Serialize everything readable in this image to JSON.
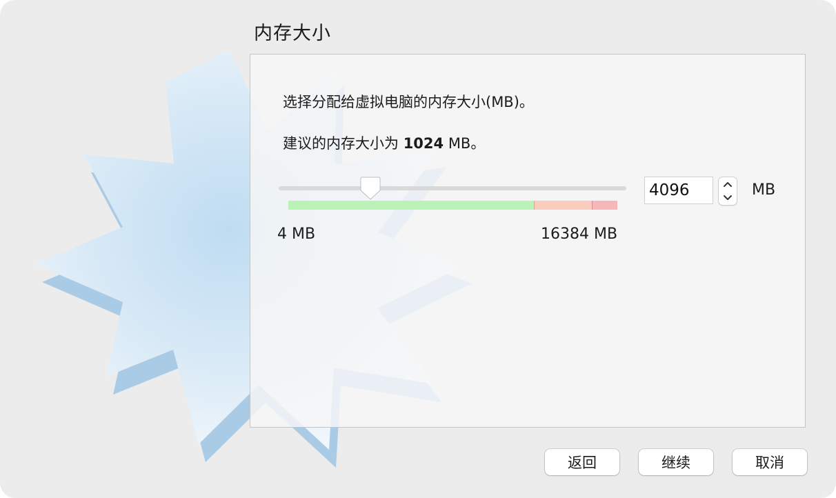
{
  "section_title": "内存大小",
  "description": "选择分配给虚拟电脑的内存大小(MB)。",
  "recommendation": {
    "prefix": "建议的内存大小为 ",
    "value": "1024",
    "suffix": " MB。"
  },
  "slider": {
    "value_mb": 4096,
    "min_label": "4 MB",
    "max_label": "16384 MB",
    "range_colors": {
      "safe": "#b9f3b5",
      "warning": "#f9ccbe",
      "danger": "#f7b6b9"
    }
  },
  "memory_input": {
    "value": "4096"
  },
  "unit_label": "MB",
  "buttons": {
    "back": "返回",
    "next": "继续",
    "cancel": "取消"
  },
  "icons": {
    "stepper_up": "chevron-up-icon",
    "stepper_down": "chevron-down-icon",
    "watermark": "starburst-logo"
  }
}
